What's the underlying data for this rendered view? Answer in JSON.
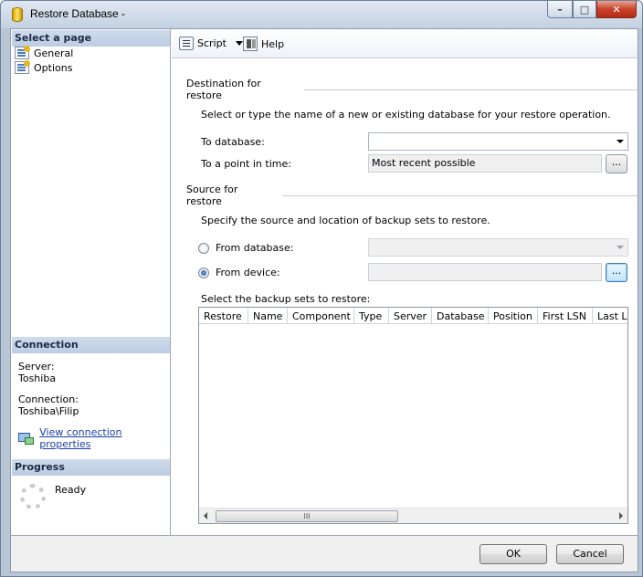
{
  "window": {
    "title": "Restore Database -",
    "buttons": {
      "minimize": "–",
      "maximize": "□",
      "close": "✕"
    }
  },
  "sidebar": {
    "select_page_header": "Select a page",
    "pages": [
      {
        "label": "General",
        "icon": "page-icon"
      },
      {
        "label": "Options",
        "icon": "page-icon"
      }
    ],
    "connection_header": "Connection",
    "server_label": "Server:",
    "server_value": "Toshiba",
    "connection_label": "Connection:",
    "connection_value": "Toshiba\\Filip",
    "view_connection_link": "View connection properties",
    "progress_header": "Progress",
    "progress_status": "Ready"
  },
  "toolbar": {
    "script_label": "Script",
    "help_label": "Help"
  },
  "destination": {
    "header": "Destination for restore",
    "description": "Select or type the name of a new or existing database for your restore operation.",
    "to_database_label": "To database:",
    "to_database_value": "",
    "point_in_time_label": "To a point in time:",
    "point_in_time_value": "Most recent possible",
    "browse_label": "..."
  },
  "source": {
    "header": "Source for restore",
    "description": "Specify the source and location of backup sets to restore.",
    "from_database_label": "From database:",
    "from_database_selected": false,
    "from_device_label": "From device:",
    "from_device_selected": true,
    "from_device_value": "",
    "browse_label": "..."
  },
  "backup_sets": {
    "label": "Select the backup sets to restore:",
    "columns": [
      "Restore",
      "Name",
      "Component",
      "Type",
      "Server",
      "Database",
      "Position",
      "First LSN",
      "Last LSN"
    ],
    "rows": [],
    "scroll_thumb": "III"
  },
  "footer": {
    "ok_label": "OK",
    "cancel_label": "Cancel"
  },
  "colors": {
    "section_header_bg": "#c6d5ea",
    "link": "#1b3fa8",
    "focus_border": "#3c7fb1"
  }
}
